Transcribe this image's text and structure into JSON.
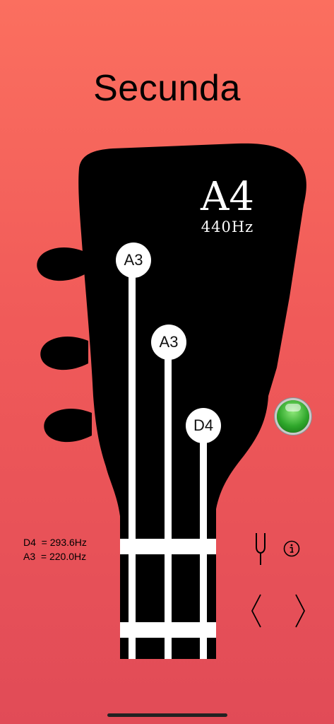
{
  "app": {
    "title": "Secunda"
  },
  "tuner": {
    "note": "A4",
    "frequency": "440Hz",
    "in_tune_led_color": "#2fa72b"
  },
  "strings": [
    {
      "label": "A3"
    },
    {
      "label": "A3"
    },
    {
      "label": "D4"
    }
  ],
  "frequency_list": [
    {
      "note": "D4",
      "sep": "  = ",
      "freq": "293.6Hz"
    },
    {
      "note": "A3",
      "sep": "  = ",
      "freq": "220.0Hz"
    }
  ],
  "controls": {
    "tuning_fork_icon": "tuning-fork-icon",
    "info_icon": "info-icon",
    "prev_icon": "chevron-left-icon",
    "next_icon": "chevron-right-icon"
  },
  "colors": {
    "background_top": "#fb6f5f",
    "background_bottom": "#e14b57",
    "headstock": "#000000",
    "strings": "#ffffff"
  }
}
